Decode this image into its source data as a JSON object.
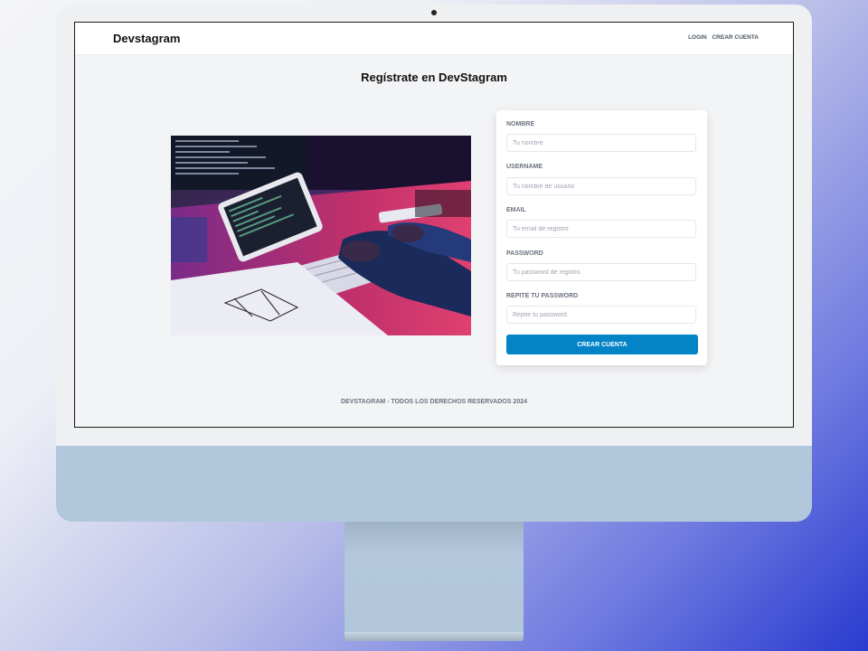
{
  "header": {
    "brand": "Devstagram",
    "nav": [
      "LOGIN",
      "CREAR CUENTA"
    ]
  },
  "main": {
    "title": "Regístrate en DevStagram",
    "form": {
      "fields": [
        {
          "label": "Nombre",
          "placeholder": "Tu nombre",
          "value": ""
        },
        {
          "label": "Username",
          "placeholder": "Tu nombre de usuario",
          "value": ""
        },
        {
          "label": "Email",
          "placeholder": "Tu email de registro",
          "value": ""
        },
        {
          "label": "Password",
          "placeholder": "Tu password de registro",
          "value": ""
        },
        {
          "label": "Repite tu password",
          "placeholder": "Repite tu password",
          "value": ""
        }
      ],
      "submit_label": "Crear Cuenta"
    }
  },
  "footer": {
    "text": "DEVSTAGRAM - TODOS LOS DERECHOS RESERVADOS 2024"
  },
  "colors": {
    "accent": "#0284c7",
    "page_bg": "#f3f4f6",
    "label": "#6b7280"
  }
}
